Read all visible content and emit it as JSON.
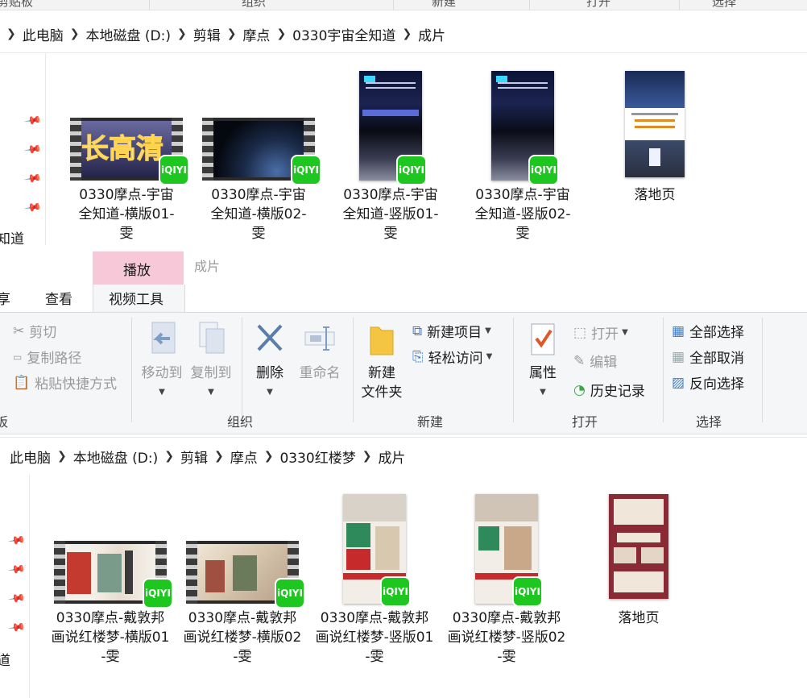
{
  "top_groups": {
    "g1": "剪贴板",
    "g2": "组织",
    "g3": "新建",
    "g4": "打开",
    "g5": "选择"
  },
  "pane1": {
    "breadcrumbs": [
      "此电脑",
      "本地磁盘 (D:)",
      "剪辑",
      "摩点",
      "0330宇宙全知道",
      "成片"
    ],
    "nav_label": "知道",
    "items": [
      {
        "label": "0330摩点-宇宙全知道-横版01-雯",
        "kind": "video-h",
        "badge": "iQIYI",
        "thumb_text": "长高清"
      },
      {
        "label": "0330摩点-宇宙全知道-横版02-雯",
        "kind": "video-h",
        "badge": "iQIYI"
      },
      {
        "label": "0330摩点-宇宙全知道-竖版01-雯",
        "kind": "video-v",
        "badge": "iQIYI"
      },
      {
        "label": "0330摩点-宇宙全知道-竖版02-雯",
        "kind": "video-v",
        "badge": "iQIYI"
      },
      {
        "label": "落地页",
        "kind": "image"
      }
    ]
  },
  "ribbon": {
    "context_tab": "播放",
    "context_title": "成片",
    "tabs": [
      "享",
      "查看",
      "视频工具"
    ],
    "clipboard": {
      "cut": "剪切",
      "copy_path": "复制路径",
      "paste_shortcut": "粘贴快捷方式",
      "group": "板"
    },
    "organize": {
      "move_to": "移动到",
      "copy_to": "复制到",
      "delete": "删除",
      "rename": "重命名",
      "group": "组织"
    },
    "new": {
      "new_folder_line1": "新建",
      "new_folder_line2": "文件夹",
      "new_item": "新建项目",
      "easy_access": "轻松访问",
      "group": "新建"
    },
    "open": {
      "properties": "属性",
      "open": "打开",
      "edit": "编辑",
      "history": "历史记录",
      "group": "打开"
    },
    "select": {
      "select_all": "全部选择",
      "select_none": "全部取消",
      "invert": "反向选择",
      "group": "选择"
    }
  },
  "pane2": {
    "breadcrumbs": [
      "此电脑",
      "本地磁盘 (D:)",
      "剪辑",
      "摩点",
      "0330红楼梦",
      "成片"
    ],
    "nav_label": "道",
    "items": [
      {
        "label": "0330摩点-戴敦邦画说红楼梦-横版01-雯",
        "kind": "video-h",
        "badge": "iQIYI"
      },
      {
        "label": "0330摩点-戴敦邦画说红楼梦-横版02-雯",
        "kind": "video-h",
        "badge": "iQIYI"
      },
      {
        "label": "0330摩点-戴敦邦画说红楼梦-竖版01-雯",
        "kind": "video-v",
        "badge": "iQIYI"
      },
      {
        "label": "0330摩点-戴敦邦画说红楼梦-竖版02-雯",
        "kind": "video-v",
        "badge": "iQIYI"
      },
      {
        "label": "落地页",
        "kind": "image"
      }
    ]
  },
  "colors": {
    "context_tab": "#f6c8d8",
    "iqiyi": "#1ec620",
    "accent": "#3d7ec9"
  }
}
